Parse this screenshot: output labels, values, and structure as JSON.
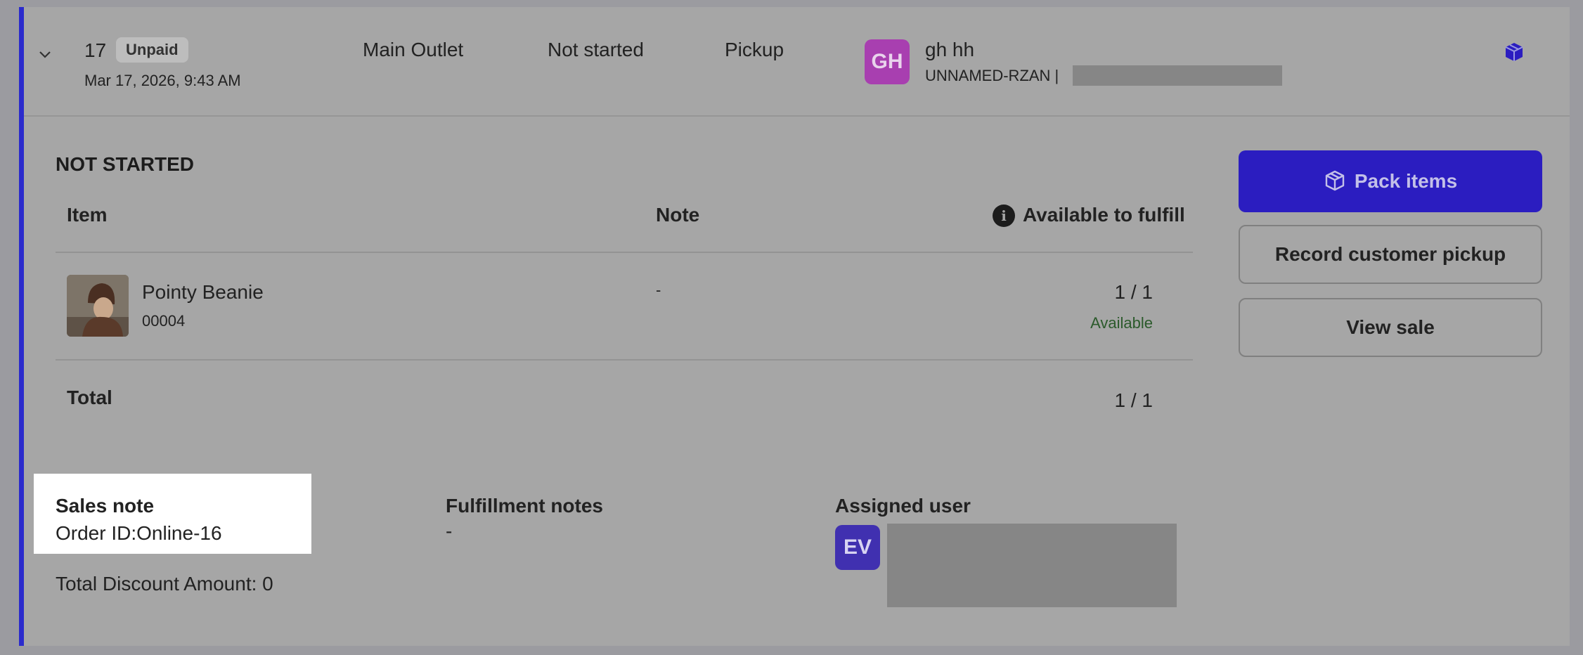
{
  "order": {
    "number": "17",
    "payment_badge": "Unpaid",
    "date": "Mar 17, 2026, 9:43 AM",
    "outlet": "Main Outlet",
    "status": "Not started",
    "fulfillment_method": "Pickup",
    "customer": {
      "initials": "GH",
      "name": "gh hh",
      "code": "UNNAMED-RZAN |",
      "avatar_color": "#a83fb0"
    }
  },
  "details": {
    "section_title": "NOT STARTED",
    "headers": {
      "item": "Item",
      "note": "Note",
      "available": "Available to fulfill"
    },
    "items": [
      {
        "name": "Pointy Beanie",
        "sku": "00004",
        "note": "-",
        "qty": "1 / 1",
        "availability": "Available"
      }
    ],
    "total_label": "Total",
    "total_qty": "1 / 1"
  },
  "actions": {
    "pack": "Pack items",
    "record_pickup": "Record customer pickup",
    "view_sale": "View sale"
  },
  "notes": {
    "sales_note_label": "Sales note",
    "sales_note_value": "Order ID:Online-16",
    "discount": "Total Discount Amount: 0",
    "fulfillment_label": "Fulfillment notes",
    "fulfillment_value": "-",
    "assigned_label": "Assigned user",
    "assigned_initials": "EV",
    "assigned_avatar_color": "#4030b0"
  },
  "colors": {
    "accent": "#2b2bcc",
    "primary_button": "#2b1dc0",
    "available_text": "#2b5a2b"
  },
  "icons": [
    "chevron-down-icon",
    "package-icon",
    "info-icon"
  ]
}
